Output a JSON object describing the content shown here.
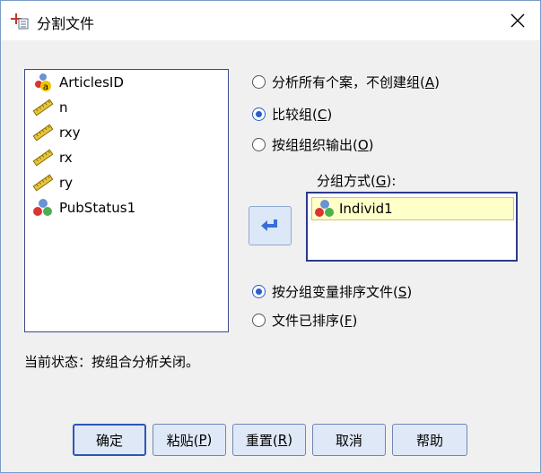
{
  "window": {
    "title": "分割文件"
  },
  "variables": [
    {
      "name": "ArticlesID",
      "icon": "nominal-string-icon"
    },
    {
      "name": "n",
      "icon": "scale-ruler-icon"
    },
    {
      "name": "rxy",
      "icon": "scale-ruler-icon"
    },
    {
      "name": "rx",
      "icon": "scale-ruler-icon"
    },
    {
      "name": "ry",
      "icon": "scale-ruler-icon"
    },
    {
      "name": "PubStatus1",
      "icon": "nominal-icon"
    }
  ],
  "mode_options": [
    {
      "pre": "分析所有个案，不创建组(",
      "key": "A",
      "post": ")",
      "checked": false
    },
    {
      "pre": "比较组(",
      "key": "C",
      "post": ")",
      "checked": true
    },
    {
      "pre": "按组组织输出(",
      "key": "O",
      "post": ")",
      "checked": false
    }
  ],
  "groups_by": {
    "pre": "分组方式(",
    "key": "G",
    "post": "):",
    "items": [
      "Individ1"
    ]
  },
  "sort_options": [
    {
      "pre": "按分组变量排序文件(",
      "key": "S",
      "post": ")",
      "checked": true
    },
    {
      "pre": "文件已排序(",
      "key": "F",
      "post": ")",
      "checked": false
    }
  ],
  "status_text": "当前状态：按组合分析关闭。",
  "buttons": {
    "ok": "确定",
    "paste": {
      "pre": "粘贴(",
      "key": "P",
      "post": ")"
    },
    "reset": {
      "pre": "重置(",
      "key": "R",
      "post": ")"
    },
    "cancel": "取消",
    "help": "帮助"
  },
  "colors": {
    "accent": "#2a5ec8",
    "list_border": "#2c3a8a",
    "selection": "#ffffc8"
  }
}
